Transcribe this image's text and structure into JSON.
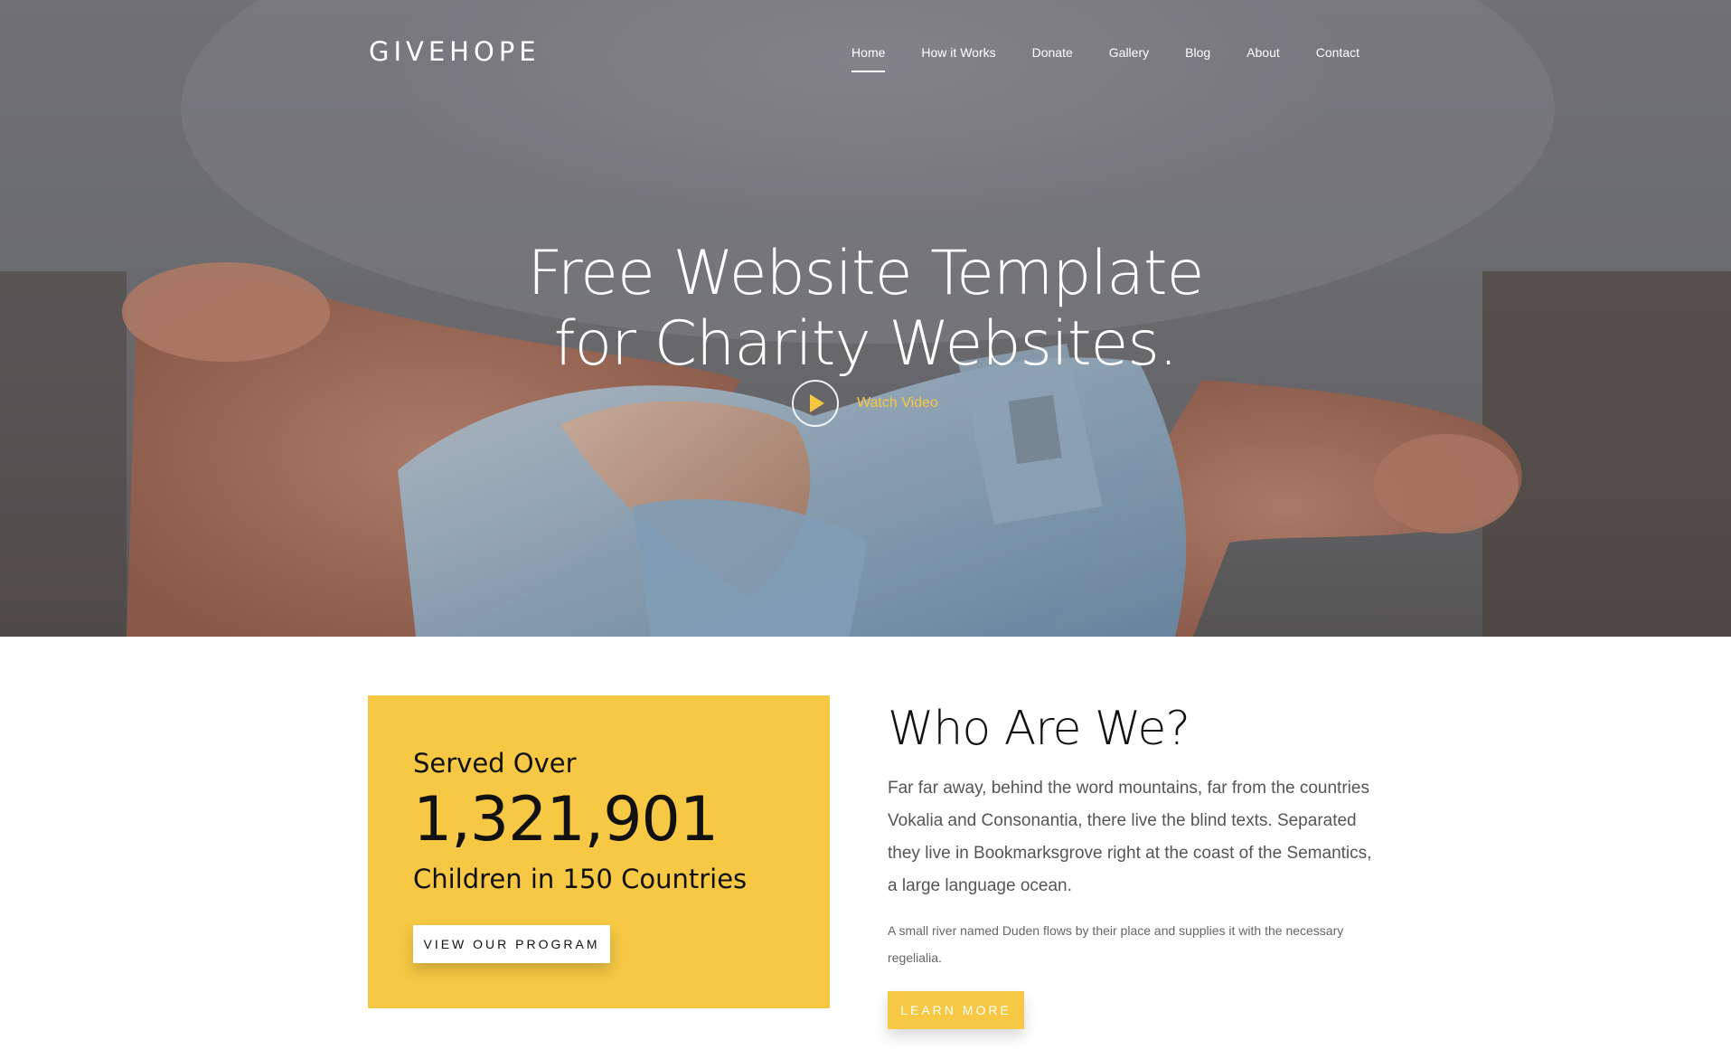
{
  "nav": {
    "brand": "GIVEHOPE",
    "items": [
      {
        "label": "Home",
        "active": true
      },
      {
        "label": "How it Works",
        "active": false
      },
      {
        "label": "Donate",
        "active": false
      },
      {
        "label": "Gallery",
        "active": false
      },
      {
        "label": "Blog",
        "active": false
      },
      {
        "label": "About",
        "active": false
      },
      {
        "label": "Contact",
        "active": false
      }
    ]
  },
  "hero": {
    "title_line1": "Free Website Template",
    "title_line2": "for Charity Websites.",
    "watch_label": "Watch Video",
    "play_icon": "play-icon"
  },
  "stats": {
    "served": "Served Over",
    "number": "1,321,901",
    "children": "Children in 150 Countries",
    "button": "VIEW OUR PROGRAM"
  },
  "about": {
    "title": "Who Are We?",
    "lead": "Far far away, behind the word mountains, far from the countries Vokalia and Consonantia, there live the blind texts. Separated they live in Bookmarksgrove right at the coast of the Semantics, a large language ocean.",
    "small": "A small river named Duden flows by their place and supplies it with the necessary regelialia.",
    "button": "LEARN MORE"
  },
  "colors": {
    "accent": "#f6c843",
    "text_dark": "#111111",
    "text_muted": "#555555"
  }
}
